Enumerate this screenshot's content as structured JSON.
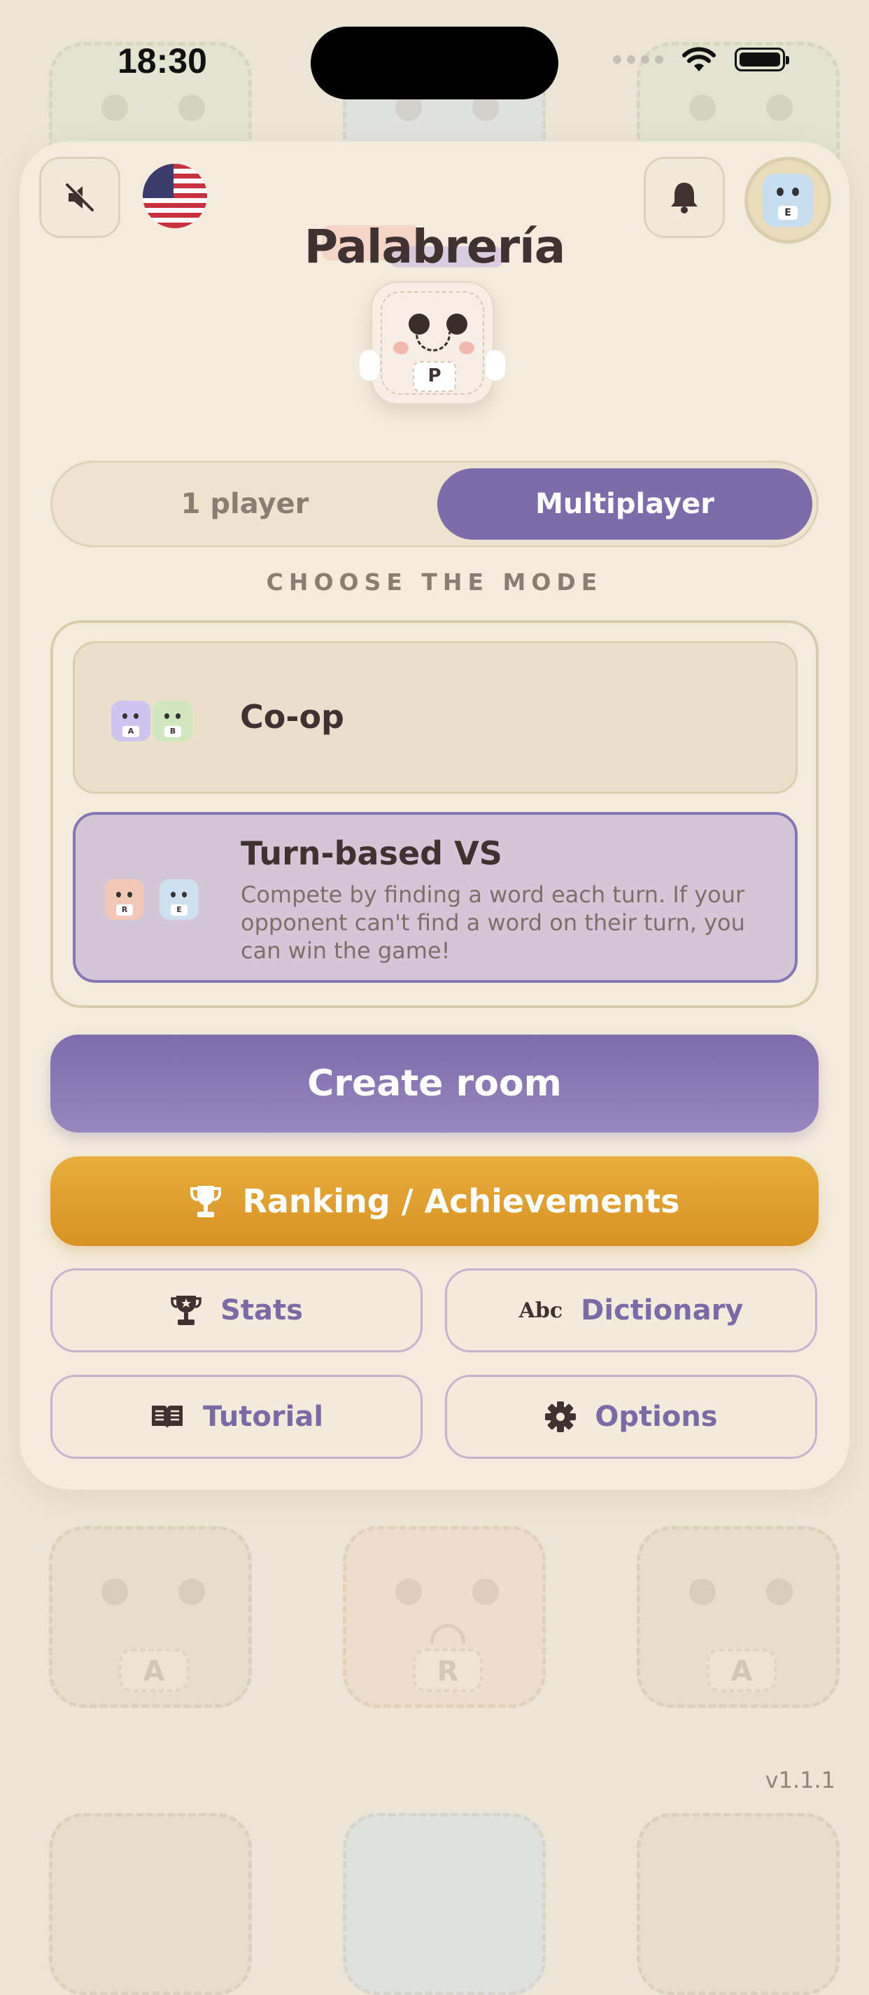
{
  "status_bar": {
    "time": "18:30"
  },
  "app": {
    "title": "Palabrería",
    "mascot_letter": "P",
    "avatar_letter": "E"
  },
  "player_toggle": {
    "one_player": "1 player",
    "multiplayer": "Multiplayer",
    "selected": "Multiplayer"
  },
  "section_label": "CHOOSE THE MODE",
  "modes": [
    {
      "title": "Co-op",
      "letters": [
        "A",
        "B"
      ],
      "selected": false
    },
    {
      "title": "Turn-based VS",
      "description": "Compete by finding a word each turn. If your opponent can't find a word on their turn, you can win the game!",
      "letters": [
        "R",
        "E"
      ],
      "selected": true
    }
  ],
  "buttons": {
    "create_room": "Create room",
    "ranking": "Ranking / Achievements",
    "stats": "Stats",
    "dictionary": "Dictionary",
    "dictionary_icon": "Abc",
    "tutorial": "Tutorial",
    "options": "Options"
  },
  "background_letters": [
    "A",
    "R",
    "A"
  ],
  "version": "v1.1.1",
  "colors": {
    "primary": "#7d6cab",
    "gold": "#e0a030",
    "card": "#f3ecdc",
    "background": "#ece5d6"
  },
  "icons": [
    "muted-speaker-icon",
    "us-flag-icon",
    "bell-icon",
    "trophy-icon",
    "stats-trophy-icon",
    "book-icon",
    "gear-icon"
  ]
}
